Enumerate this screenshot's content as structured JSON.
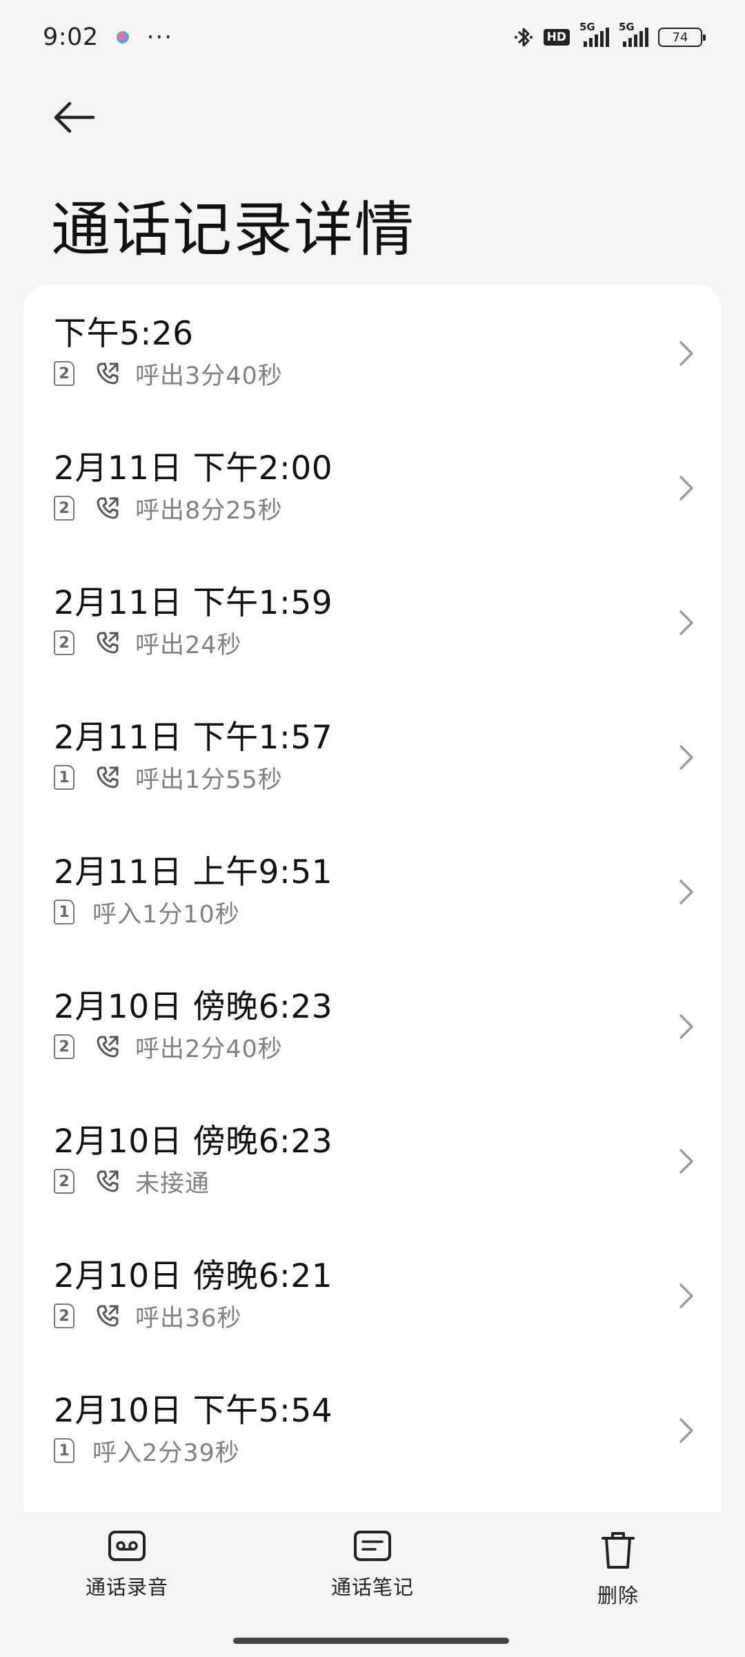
{
  "status_bar": {
    "time": "9:02",
    "more": "···",
    "hd": "HD",
    "net1": "5G",
    "net2": "5G",
    "battery": "74"
  },
  "header": {
    "title": "通话记录详情"
  },
  "calls": [
    {
      "time": "下午5:26",
      "sim": "2",
      "icon": "outgoing-call-icon",
      "desc": "呼出3分40秒"
    },
    {
      "time": "2月11日 下午2:00",
      "sim": "2",
      "icon": "outgoing-call-icon",
      "desc": "呼出8分25秒"
    },
    {
      "time": "2月11日 下午1:59",
      "sim": "2",
      "icon": "outgoing-call-icon",
      "desc": "呼出24秒"
    },
    {
      "time": "2月11日 下午1:57",
      "sim": "1",
      "icon": "outgoing-call-icon",
      "desc": "呼出1分55秒"
    },
    {
      "time": "2月11日 上午9:51",
      "sim": "1",
      "icon": "",
      "desc": "呼入1分10秒"
    },
    {
      "time": "2月10日 傍晚6:23",
      "sim": "2",
      "icon": "outgoing-call-icon",
      "desc": "呼出2分40秒"
    },
    {
      "time": "2月10日 傍晚6:23",
      "sim": "2",
      "icon": "outgoing-call-icon",
      "desc": "未接通"
    },
    {
      "time": "2月10日 傍晚6:21",
      "sim": "2",
      "icon": "outgoing-call-icon",
      "desc": "呼出36秒"
    },
    {
      "time": "2月10日 下午5:54",
      "sim": "1",
      "icon": "",
      "desc": "呼入2分39秒"
    }
  ],
  "toolbar": {
    "recording": "通话录音",
    "notes": "通话笔记",
    "delete": "删除"
  }
}
